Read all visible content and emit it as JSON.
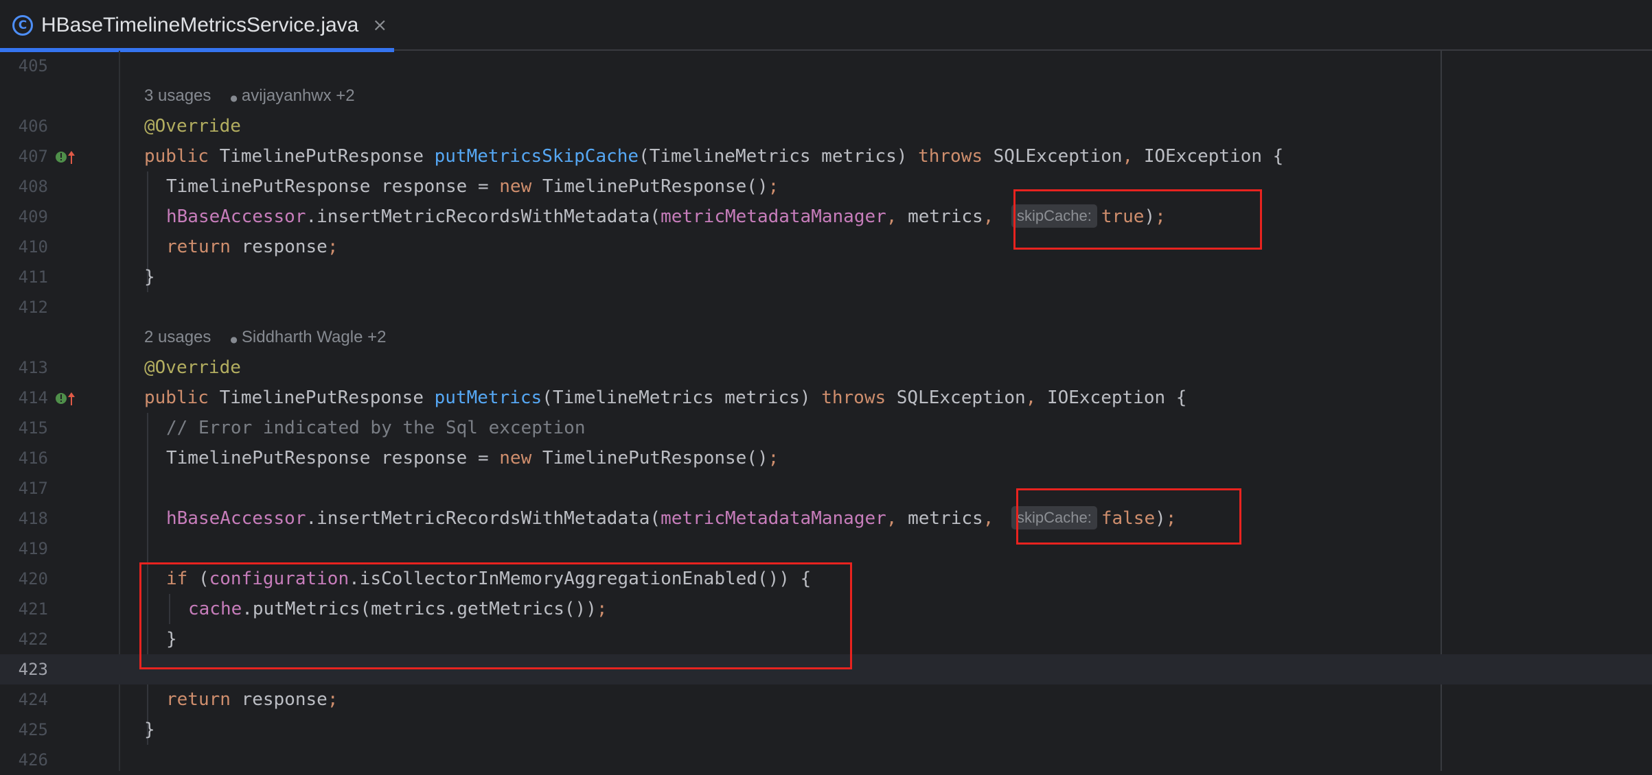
{
  "tab": {
    "icon": "class-icon",
    "icon_glyph": "C",
    "title": "HBaseTimelineMetricsService.java",
    "close": "×"
  },
  "editor": {
    "lines": [
      {
        "num": "405"
      },
      {
        "meta": true,
        "usages": "3 usages",
        "author": "avijayanhwx +2"
      },
      {
        "num": "406",
        "tokens": [
          {
            "t": "@Override",
            "c": "ann"
          }
        ]
      },
      {
        "num": "407",
        "marker": true,
        "tokens": [
          {
            "t": "public ",
            "c": "kw"
          },
          {
            "t": "TimelinePutResponse "
          },
          {
            "t": "putMetricsSkipCache",
            "c": "fn"
          },
          {
            "t": "(TimelineMetrics metrics) "
          },
          {
            "t": "throws ",
            "c": "kw"
          },
          {
            "t": "SQLException"
          },
          {
            "t": ", ",
            "c": "kw"
          },
          {
            "t": "IOException {"
          }
        ]
      },
      {
        "num": "408",
        "indent": 1,
        "tokens": [
          {
            "t": "TimelinePutResponse response = "
          },
          {
            "t": "new ",
            "c": "kw"
          },
          {
            "t": "TimelinePutResponse()"
          },
          {
            "t": ";",
            "c": "kw"
          }
        ]
      },
      {
        "num": "409",
        "indent": 1,
        "tokens": [
          {
            "t": "hBaseAccessor",
            "c": "fld"
          },
          {
            "t": ".insertMetricRecordsWithMetadata("
          },
          {
            "t": "metricMetadataManager",
            "c": "fld"
          },
          {
            "t": ", ",
            "c": "kw"
          },
          {
            "t": "metrics"
          },
          {
            "t": ", ",
            "c": "kw"
          },
          {
            "t": "skipCache:",
            "c": "hint"
          },
          {
            "t": "true",
            "c": "kw"
          },
          {
            "t": ")"
          },
          {
            "t": ";",
            "c": "kw"
          }
        ]
      },
      {
        "num": "410",
        "indent": 1,
        "tokens": [
          {
            "t": "return ",
            "c": "kw"
          },
          {
            "t": "response"
          },
          {
            "t": ";",
            "c": "kw"
          }
        ]
      },
      {
        "num": "411",
        "tokens": [
          {
            "t": "}"
          }
        ]
      },
      {
        "num": "412"
      },
      {
        "meta": true,
        "usages": "2 usages",
        "author": "Siddharth Wagle +2"
      },
      {
        "num": "413",
        "tokens": [
          {
            "t": "@Override",
            "c": "ann"
          }
        ]
      },
      {
        "num": "414",
        "marker": true,
        "tokens": [
          {
            "t": "public ",
            "c": "kw"
          },
          {
            "t": "TimelinePutResponse "
          },
          {
            "t": "putMetrics",
            "c": "fn"
          },
          {
            "t": "(TimelineMetrics metrics) "
          },
          {
            "t": "throws ",
            "c": "kw"
          },
          {
            "t": "SQLException"
          },
          {
            "t": ", ",
            "c": "kw"
          },
          {
            "t": "IOException {"
          }
        ]
      },
      {
        "num": "415",
        "indent": 1,
        "tokens": [
          {
            "t": "// Error indicated by the Sql exception",
            "c": "cmt"
          }
        ]
      },
      {
        "num": "416",
        "indent": 1,
        "tokens": [
          {
            "t": "TimelinePutResponse response = "
          },
          {
            "t": "new ",
            "c": "kw"
          },
          {
            "t": "TimelinePutResponse()"
          },
          {
            "t": ";",
            "c": "kw"
          }
        ]
      },
      {
        "num": "417"
      },
      {
        "num": "418",
        "indent": 1,
        "tokens": [
          {
            "t": "hBaseAccessor",
            "c": "fld"
          },
          {
            "t": ".insertMetricRecordsWithMetadata("
          },
          {
            "t": "metricMetadataManager",
            "c": "fld"
          },
          {
            "t": ", ",
            "c": "kw"
          },
          {
            "t": "metrics"
          },
          {
            "t": ", ",
            "c": "kw"
          },
          {
            "t": "skipCache:",
            "c": "hint"
          },
          {
            "t": "false",
            "c": "kw"
          },
          {
            "t": ")"
          },
          {
            "t": ";",
            "c": "kw"
          }
        ]
      },
      {
        "num": "419"
      },
      {
        "num": "420",
        "indent": 1,
        "tokens": [
          {
            "t": "if ",
            "c": "kw"
          },
          {
            "t": "("
          },
          {
            "t": "configuration",
            "c": "fld"
          },
          {
            "t": ".isCollectorInMemoryAggregationEnabled()) {"
          }
        ]
      },
      {
        "num": "421",
        "indent": 2,
        "tokens": [
          {
            "t": "cache",
            "c": "fld"
          },
          {
            "t": ".putMetrics(metrics.getMetrics())"
          },
          {
            "t": ";",
            "c": "kw"
          }
        ]
      },
      {
        "num": "422",
        "indent": 1,
        "tokens": [
          {
            "t": "}"
          }
        ]
      },
      {
        "num": "423",
        "current": true
      },
      {
        "num": "424",
        "indent": 1,
        "tokens": [
          {
            "t": "return ",
            "c": "kw"
          },
          {
            "t": "response"
          },
          {
            "t": ";",
            "c": "kw"
          }
        ]
      },
      {
        "num": "425",
        "tokens": [
          {
            "t": "}"
          }
        ]
      },
      {
        "num": "426"
      }
    ]
  },
  "colors": {
    "keyword": "#cf8e6d",
    "annotation": "#b3ae60",
    "method": "#56a8f5",
    "field": "#c77dbb",
    "comment": "#7a7e85",
    "highlight_box": "#e8231f",
    "tab_accent": "#3574f0"
  }
}
